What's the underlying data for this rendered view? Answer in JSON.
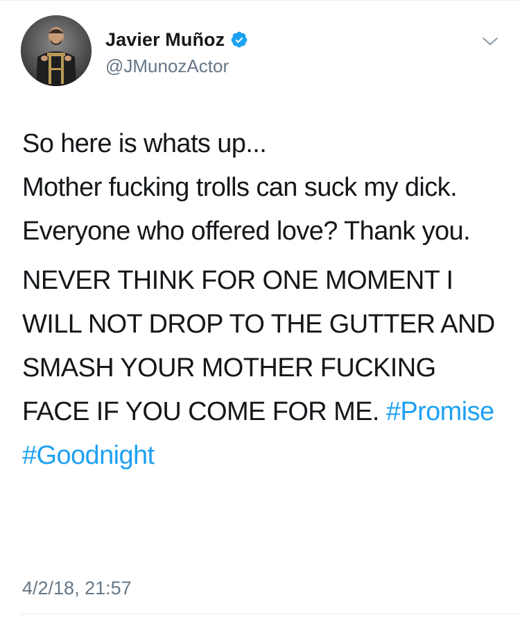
{
  "author": {
    "display_name": "Javier Muñoz",
    "handle": "@JMunozActor",
    "verified": true,
    "avatar_icon": "profile-photo"
  },
  "tweet": {
    "lines": [
      "So here is whats up...",
      "Mother fucking trolls can suck my dick.",
      "Everyone who offered love? Thank you."
    ],
    "shout": "NEVER THINK FOR ONE MOMENT I WILL NOT DROP TO THE GUTTER AND SMASH YOUR MOTHER FUCKING FACE IF YOU COME FOR ME.",
    "hashtags": [
      "#Promise",
      "#Goodnight"
    ],
    "timestamp": "4/2/18, 21:57"
  },
  "colors": {
    "text": "#14171a",
    "muted": "#657786",
    "link": "#1da1f2",
    "verified": "#1da1f2",
    "divider": "#e6ecf0"
  },
  "icons": {
    "verified": "verified-badge-icon",
    "menu": "chevron-down-icon"
  }
}
